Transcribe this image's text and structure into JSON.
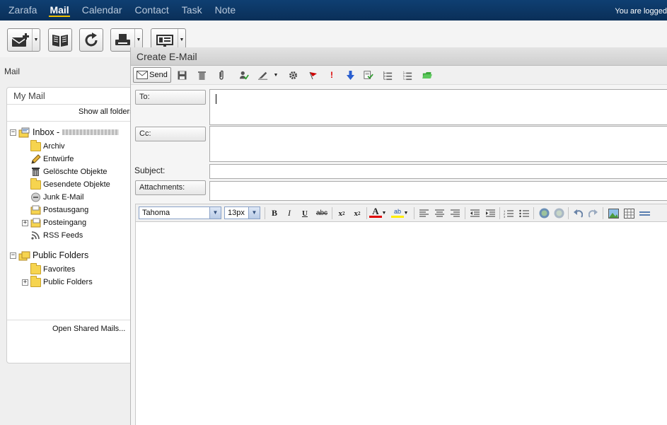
{
  "nav": {
    "items": [
      {
        "label": "Zarafa",
        "active": false
      },
      {
        "label": "Mail",
        "active": true
      },
      {
        "label": "Calendar",
        "active": false
      },
      {
        "label": "Contact",
        "active": false
      },
      {
        "label": "Task",
        "active": false
      },
      {
        "label": "Note",
        "active": false
      }
    ],
    "user_status": "You are logged"
  },
  "toolbar": {
    "buttons": [
      "new-mail",
      "address-book",
      "refresh",
      "print",
      "preview-pane"
    ]
  },
  "sidebar": {
    "section_label": "Mail",
    "panel_title": "My Mail",
    "show_all": "Show all folders",
    "inbox": {
      "label": "Inbox -"
    },
    "inbox_children": [
      {
        "label": "Archiv",
        "icon": "folder-icon",
        "expandable": false
      },
      {
        "label": "Entwürfe",
        "icon": "pencil-icon",
        "expandable": false
      },
      {
        "label": "Gelöschte Objekte",
        "icon": "trash-icon",
        "expandable": false
      },
      {
        "label": "Gesendete Objekte",
        "icon": "sent-folder-icon",
        "expandable": false
      },
      {
        "label": "Junk E-Mail",
        "icon": "junk-icon",
        "expandable": false
      },
      {
        "label": "Postausgang",
        "icon": "outbox-icon",
        "expandable": false
      },
      {
        "label": "Posteingang",
        "icon": "inbox-folder-icon",
        "expandable": true
      },
      {
        "label": "RSS Feeds",
        "icon": "rss-icon",
        "expandable": false
      }
    ],
    "public": {
      "label": "Public Folders"
    },
    "public_children": [
      {
        "label": "Favorites",
        "icon": "favorites-folder-icon",
        "expandable": false
      },
      {
        "label": "Public Folders",
        "icon": "folder-icon",
        "expandable": true
      }
    ],
    "open_shared": "Open Shared Mails..."
  },
  "compose": {
    "title": "Create E-Mail",
    "send_label": "Send",
    "to_label": "To:",
    "cc_label": "Cc:",
    "subject_label": "Subject:",
    "attachments_label": "Attachments:",
    "to_value": "",
    "cc_value": "",
    "subject_value": "",
    "font_family": "Tahoma",
    "font_size": "13px",
    "colors": {
      "flag": "#cc0000",
      "priority_high": "#dd0000",
      "priority_low": "#2a5fd0",
      "font_color": "#e00000",
      "highlight": "#ffee00"
    }
  }
}
